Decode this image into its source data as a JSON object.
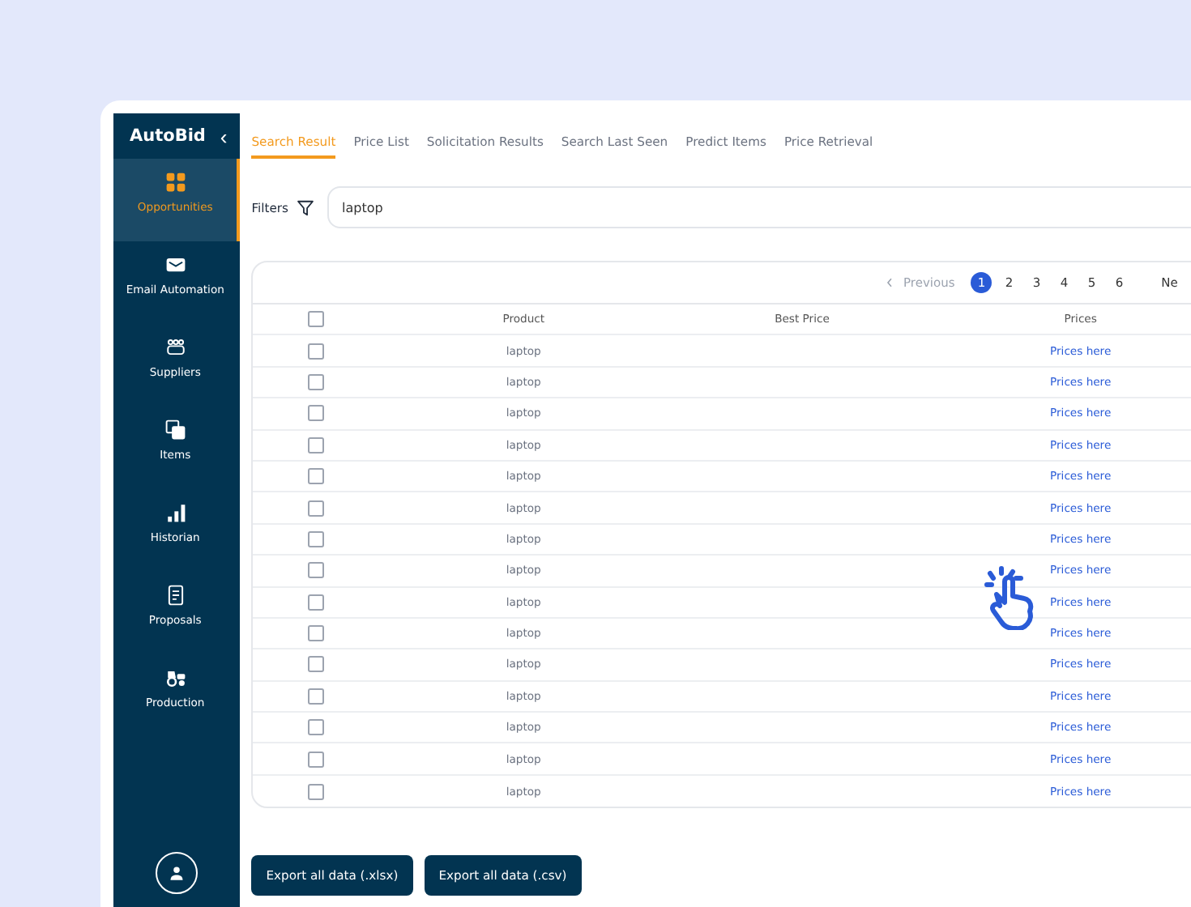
{
  "sidebar": {
    "brand": "AutoBid",
    "collapse_glyph": "‹",
    "items": [
      {
        "label": "Opportunities",
        "kind": "grid",
        "selected": true
      },
      {
        "label": "Email Automation",
        "kind": "mail",
        "selected": false
      },
      {
        "label": "Suppliers",
        "kind": "people",
        "selected": false
      },
      {
        "label": "Items",
        "kind": "stack",
        "selected": false
      },
      {
        "label": "Historian",
        "kind": "bars",
        "selected": false
      },
      {
        "label": "Proposals",
        "kind": "doc",
        "selected": false
      },
      {
        "label": "Production",
        "kind": "tractor",
        "selected": false
      }
    ]
  },
  "tabs": [
    {
      "label": "Search Result",
      "selected": true
    },
    {
      "label": "Price List",
      "selected": false
    },
    {
      "label": "Solicitation Results",
      "selected": false
    },
    {
      "label": "Search Last Seen",
      "selected": false
    },
    {
      "label": "Predict Items",
      "selected": false
    },
    {
      "label": "Price Retrieval",
      "selected": false
    }
  ],
  "filters": {
    "label": "Filters",
    "value": "laptop"
  },
  "pagination": {
    "previous": "Previous",
    "pages": [
      {
        "label": "1",
        "selected": true
      },
      {
        "label": "2",
        "selected": false
      },
      {
        "label": "3",
        "selected": false
      },
      {
        "label": "4",
        "selected": false
      },
      {
        "label": "5",
        "selected": false
      },
      {
        "label": "6",
        "selected": false
      }
    ],
    "next": "Ne"
  },
  "table": {
    "header_checked": false,
    "columns": [
      "Product",
      "Best Price",
      "Prices"
    ],
    "rows": [
      {
        "checked": false,
        "product": "laptop",
        "prices": "Prices here"
      },
      {
        "checked": false,
        "product": "laptop",
        "prices": "Prices here"
      },
      {
        "checked": false,
        "product": "laptop",
        "prices": "Prices here"
      },
      {
        "checked": false,
        "product": "laptop",
        "prices": "Prices here"
      },
      {
        "checked": false,
        "product": "laptop",
        "prices": "Prices here"
      },
      {
        "checked": false,
        "product": "laptop",
        "prices": "Prices here"
      },
      {
        "checked": false,
        "product": "laptop",
        "prices": "Prices here"
      },
      {
        "checked": false,
        "product": "laptop",
        "prices": "Prices here"
      },
      {
        "checked": false,
        "product": "laptop",
        "prices": "Prices here"
      },
      {
        "checked": false,
        "product": "laptop",
        "prices": "Prices here"
      },
      {
        "checked": false,
        "product": "laptop",
        "prices": "Prices here"
      },
      {
        "checked": false,
        "product": "laptop",
        "prices": "Prices here"
      },
      {
        "checked": false,
        "product": "laptop",
        "prices": "Prices here"
      },
      {
        "checked": false,
        "product": "laptop",
        "prices": "Prices here"
      },
      {
        "checked": false,
        "product": "laptop",
        "prices": "Prices here"
      }
    ]
  },
  "buttons": [
    "Export all data (.xlsx)",
    "Export all data (.csv)"
  ]
}
